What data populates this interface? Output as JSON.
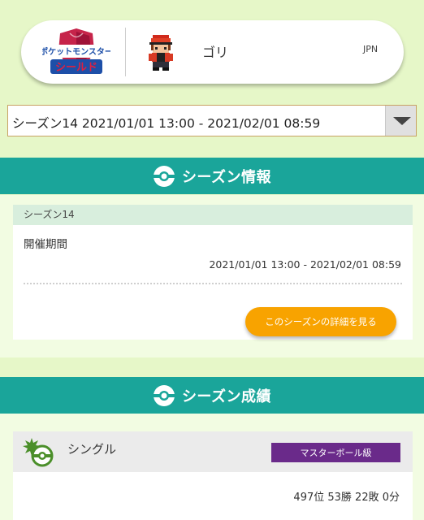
{
  "profile": {
    "game_logo_line1": "ポケットモンスター",
    "game_logo_line2": "シールド",
    "trainer_name": "ゴリ",
    "country": "JPN"
  },
  "season_select": {
    "selected": "シーズン14 2021/01/01 13:00 - 2021/02/01 08:59"
  },
  "season_info": {
    "section_title": "シーズン情報",
    "card_header": "シーズン14",
    "period_label": "開催期間",
    "period_value": "2021/01/01 13:00 - 2021/02/01 08:59",
    "detail_button": "このシーズンの詳細を見る"
  },
  "season_results": {
    "section_title": "シーズン成績",
    "battle_type": "シングル",
    "rank_class": "マスターボール級",
    "record": "497位 53勝 22敗 0分"
  },
  "colors": {
    "background": "#e6f7c8",
    "band": "#1aa59a",
    "button": "#f8a300",
    "badge": "#6a2a8a"
  }
}
